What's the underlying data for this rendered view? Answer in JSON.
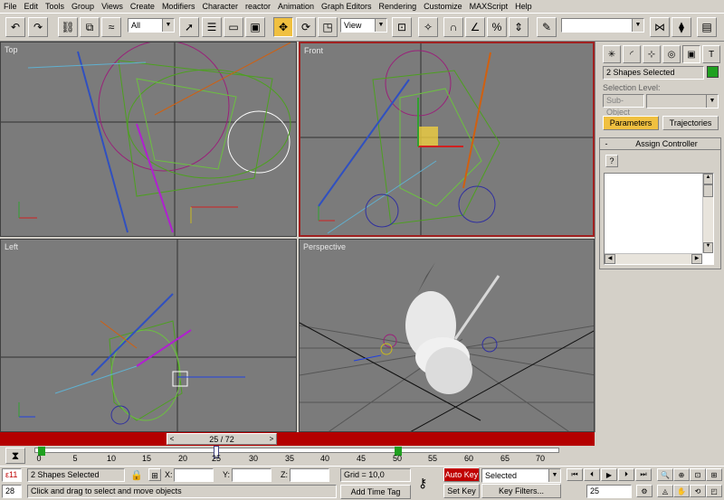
{
  "menu": [
    "File",
    "Edit",
    "Tools",
    "Group",
    "Views",
    "Create",
    "Modifiers",
    "Character",
    "reactor",
    "Animation",
    "Graph Editors",
    "Rendering",
    "Customize",
    "MAXScript",
    "Help"
  ],
  "toolbar": {
    "selection_filter": "All",
    "coord_system": "View"
  },
  "viewports": {
    "top": "Top",
    "front": "Front",
    "left": "Left",
    "perspective": "Perspective"
  },
  "command_panel": {
    "selection_name": "2 Shapes Selected",
    "selection_level_label": "Selection Level:",
    "sub_object_label": "Sub-Object",
    "tabs": [
      "Parameters",
      "Trajectories"
    ],
    "rollout_title": "Assign Controller",
    "rollout_collapse": "-",
    "assign_button": "?"
  },
  "timeline": {
    "slider_text": "25 / 72",
    "ticks": [
      "0",
      "5",
      "10",
      "15",
      "20",
      "25",
      "30",
      "35",
      "40",
      "45",
      "50",
      "55",
      "60",
      "65",
      "70"
    ]
  },
  "status": {
    "maxscript_label": "ε11",
    "listener_value": "28",
    "selection_info": "2 Shapes Selected",
    "prompt": "Click and drag to select and move objects",
    "x_label": "X:",
    "y_label": "Y:",
    "z_label": "Z:",
    "grid": "Grid = 10,0",
    "add_time_tag": "Add Time Tag",
    "auto_key": "Auto Key",
    "set_key": "Set Key",
    "key_mode": "Selected",
    "key_filters": "Key Filters...",
    "current_frame": "25"
  },
  "colors": {
    "active_border": "#a02020",
    "highlight": "#f0c040",
    "timebar": "#b40000",
    "viewport_bg": "#7b7b7b"
  }
}
